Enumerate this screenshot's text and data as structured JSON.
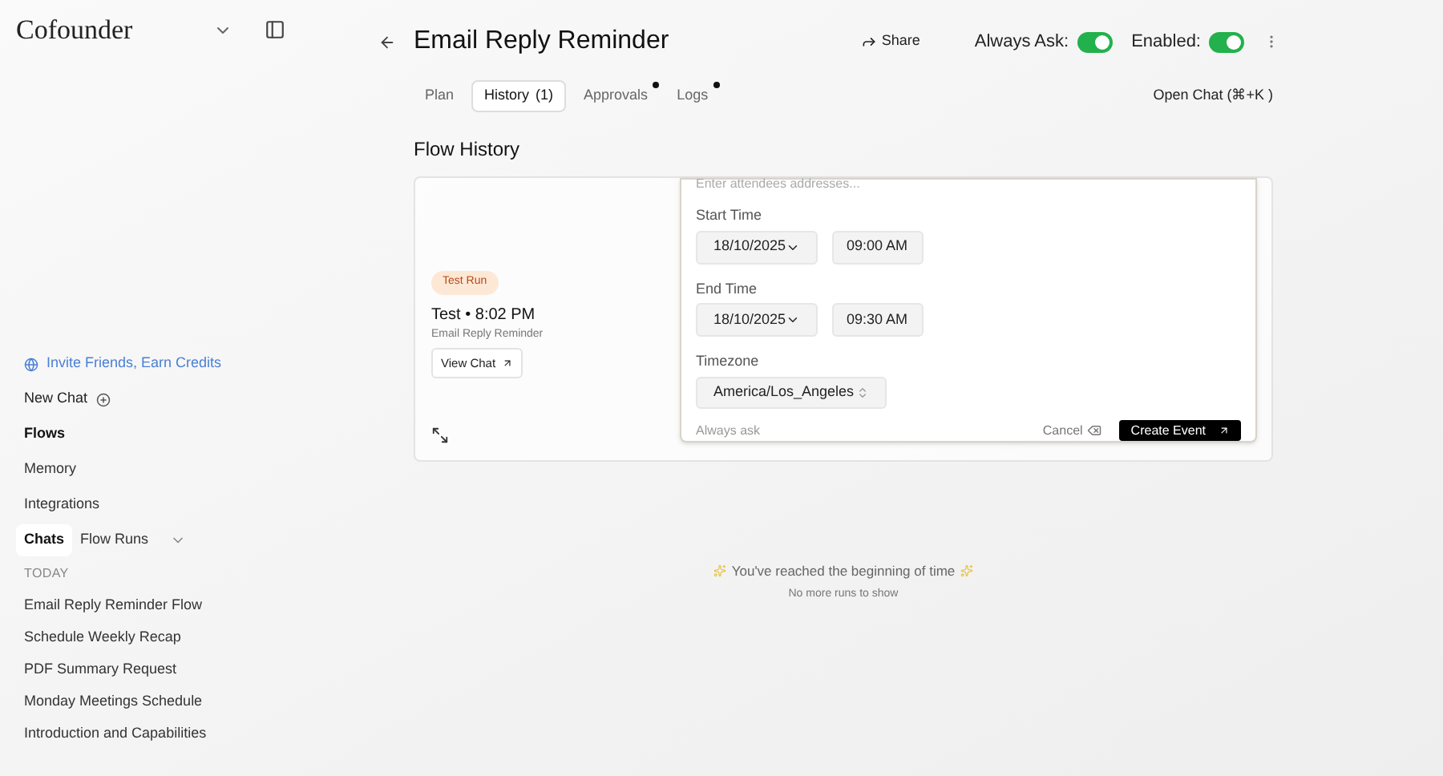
{
  "sidebar": {
    "brand": "Cofounder",
    "invite": "Invite Friends, Earn Credits",
    "new_chat": "New Chat",
    "nav": [
      {
        "label": "Flows",
        "selected": true
      },
      {
        "label": "Memory",
        "selected": false
      },
      {
        "label": "Integrations",
        "selected": false
      }
    ],
    "switcher": [
      {
        "label": "Chats",
        "selected": true
      },
      {
        "label": "Flow Runs",
        "selected": false
      }
    ],
    "section": "TODAY",
    "chats": [
      "Email Reply Reminder Flow",
      "Schedule Weekly Recap",
      "PDF Summary Request",
      "Monday Meetings Schedule",
      "Introduction and Capabilities"
    ]
  },
  "header": {
    "title": "Email Reply Reminder",
    "share": "Share",
    "toggles": [
      {
        "label": "Always Ask:",
        "on": true
      },
      {
        "label": "Enabled:",
        "on": true
      }
    ]
  },
  "tabs": [
    {
      "label": "Plan",
      "selected": false,
      "dot": false
    },
    {
      "label": "History",
      "count": "(1)",
      "selected": true,
      "dot": false
    },
    {
      "label": "Approvals",
      "selected": false,
      "dot": true
    },
    {
      "label": "Logs",
      "selected": false,
      "dot": true
    }
  ],
  "open_chat": "Open Chat (⌘+K )",
  "section_title": "Flow History",
  "run": {
    "badge": "Test Run",
    "title": "Test • 8:02 PM",
    "subtitle": "Email Reply Reminder",
    "view_chat": "View Chat"
  },
  "event_form": {
    "attendees_placeholder": "Enter attendees addresses...",
    "fields": [
      {
        "label": "Start Time",
        "date": "18/10/2025",
        "time": "09:00 AM"
      },
      {
        "label": "End Time",
        "date": "18/10/2025",
        "time": "09:30 AM"
      }
    ],
    "timezone_label": "Timezone",
    "timezone": "America/Los_Angeles",
    "always_ask": "Always ask",
    "cancel": "Cancel",
    "create": "Create Event"
  },
  "end_message": {
    "title": "You've reached the beginning of time",
    "subtitle": "No more runs to show"
  }
}
